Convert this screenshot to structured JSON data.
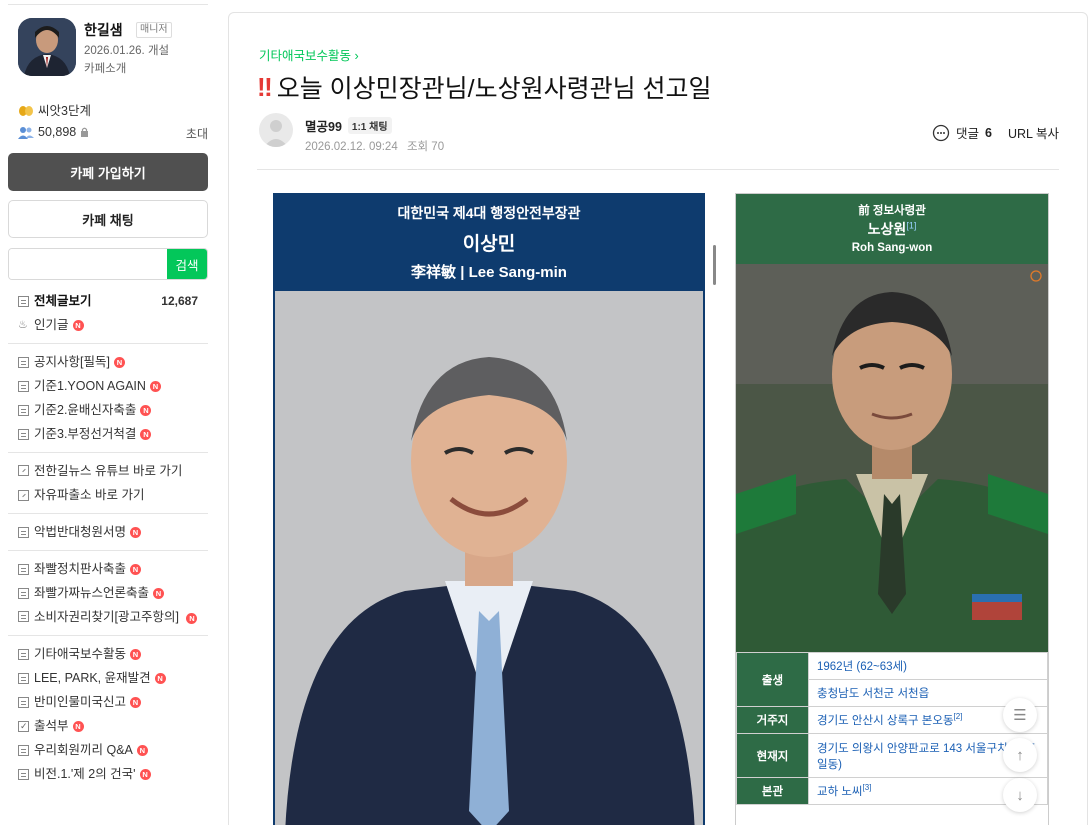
{
  "cafe": {
    "name": "한길샘",
    "role": "매니저",
    "opened": "2026.01.26. 개설",
    "intro": "카페소개",
    "level": "씨앗3단계",
    "members": "50,898",
    "invite": "초대",
    "join_button": "카페 가입하기",
    "chat_button": "카페 채팅",
    "search_placeholder": "",
    "search_button": "검색"
  },
  "menu": {
    "all_posts": "전체글보기",
    "all_count": "12,687",
    "popular": "인기글",
    "group1": [
      "공지사항[필독]",
      "기준1.YOON AGAIN",
      "기준2.윤배신자축출",
      "기준3.부정선거척결"
    ],
    "links": [
      "전한길뉴스 유튜브 바로 가기",
      "자유파출소 바로 가기"
    ],
    "petition": "악법반대청원서명",
    "group3": [
      "좌빨정치판사축출",
      "좌빨가짜뉴스언론축출",
      "소비자권리찾기[광고주항의]"
    ],
    "group4": [
      "기타애국보수활동",
      "LEE, PARK, 윤재발견",
      "반미인물미국신고",
      "출석부",
      "우리회원끼리 Q&A",
      "비전.1.'제 2의 건국'"
    ],
    "new_badge": "N"
  },
  "article": {
    "breadcrumb": "기타애국보수활동",
    "title_mark": "‼",
    "title": "오늘 이상민장관님/노상원사령관님 선고일",
    "author": "멸공99",
    "chat_badge": "1:1 채팅",
    "date": "2026.02.12. 09:24",
    "views": "조회 70",
    "comments_label": "댓글",
    "comments_count": "6",
    "url_copy": "URL 복사"
  },
  "image1": {
    "line1": "대한민국 제4대 행정안전부장관",
    "line2": "이상민",
    "line3": "李祥敏 | Lee Sang-min"
  },
  "image2": {
    "line1": "前 정보사령관",
    "line2": "노상원",
    "note": "[1]",
    "line3": "Roh Sang-won",
    "rows": [
      {
        "key": "출생",
        "v1": "1962년 (62~63세)",
        "v2": "충청남도 서천군 서천읍"
      },
      {
        "key": "거주지",
        "v1": "경기도 안산시 상록구 본오동",
        "sup": "[2]"
      },
      {
        "key": "현재지",
        "v1": "경기도 의왕시 안양판교로 143 서울구치소 (포일동)"
      },
      {
        "key": "본관",
        "v1": "교하 노씨",
        "sup": "[3]"
      }
    ]
  }
}
